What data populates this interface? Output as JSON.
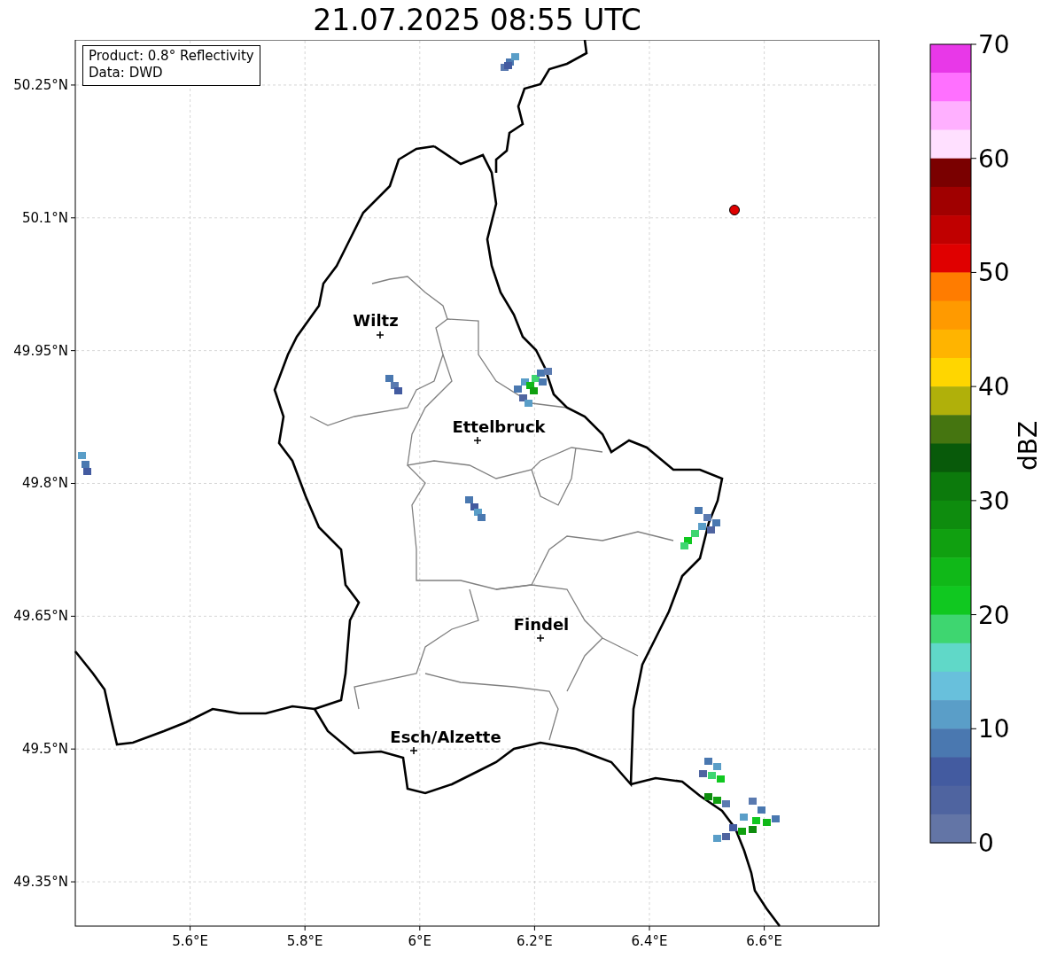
{
  "title": "21.07.2025 08:55 UTC",
  "info_box": [
    "Product: 0.8° Reflectivity",
    "Data: DWD"
  ],
  "map": {
    "x_ticks": [
      "5.6°E",
      "5.8°E",
      "6°E",
      "6.2°E",
      "6.4°E",
      "6.6°E"
    ],
    "y_ticks": [
      "50.25°N",
      "50.1°N",
      "49.95°N",
      "49.8°N",
      "49.65°N",
      "49.5°N",
      "49.35°N"
    ],
    "cities": [
      {
        "name": "Wiltz"
      },
      {
        "name": "Ettelbruck"
      },
      {
        "name": "Findel"
      },
      {
        "name": "Esch/Alzette"
      }
    ]
  },
  "colorbar": {
    "label": "dBZ",
    "ticks": [
      "70",
      "60",
      "50",
      "40",
      "30",
      "20",
      "10",
      "0"
    ],
    "bands": [
      {
        "color": "#e838e8"
      },
      {
        "color": "#ff70ff"
      },
      {
        "color": "#ffb0ff"
      },
      {
        "color": "#ffe0ff"
      },
      {
        "color": "#7a0000"
      },
      {
        "color": "#a00000"
      },
      {
        "color": "#c00000"
      },
      {
        "color": "#e00000"
      },
      {
        "color": "#ff7c00"
      },
      {
        "color": "#ff9a00"
      },
      {
        "color": "#ffb400"
      },
      {
        "color": "#ffd600"
      },
      {
        "color": "#b0b00a"
      },
      {
        "color": "#457510"
      },
      {
        "color": "#085a0a"
      },
      {
        "color": "#0c7a0c"
      },
      {
        "color": "#0e8c0e"
      },
      {
        "color": "#10a010"
      },
      {
        "color": "#10b818"
      },
      {
        "color": "#10c820"
      },
      {
        "color": "#3ed670"
      },
      {
        "color": "#60d8c8"
      },
      {
        "color": "#68c0dc"
      },
      {
        "color": "#5a9ec8"
      },
      {
        "color": "#4a78b0"
      },
      {
        "color": "#435ba0"
      },
      {
        "color": "#4f64a0"
      },
      {
        "color": "#6375a6"
      }
    ]
  }
}
